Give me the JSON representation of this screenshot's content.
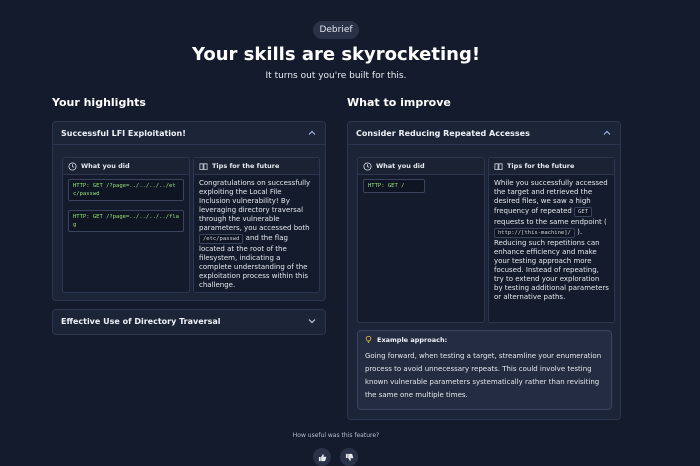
{
  "header": {
    "badge": "Debrief",
    "title": "Your skills are skyrocketing!",
    "subtitle": "It turns out you're built for this."
  },
  "highlights": {
    "heading": "Your highlights",
    "panel1": {
      "title": "Successful LFI Exploitation!",
      "what_you_did": "What you did",
      "tips": "Tips for the future",
      "code1": "HTTP: GET /?page=../../../../etc/passwd",
      "code2": "HTTP: GET /?page=../../../../flag",
      "tips_text_1": "Congratulations on successfully exploiting the Local File Inclusion vulnerability! By leveraging directory traversal through the vulnerable parameters, you accessed both",
      "tips_code": "/etc/passwd",
      "tips_text_2": "and the flag located at the root of the filesystem, indicating a complete understanding of the exploitation process within this challenge."
    },
    "panel2": {
      "title": "Effective Use of Directory Traversal"
    }
  },
  "improve": {
    "heading": "What to improve",
    "panel": {
      "title": "Consider Reducing Repeated Accesses",
      "what_you_did": "What you did",
      "tips": "Tips for the future",
      "code": "HTTP: GET /",
      "tips_text_1": "While you successfully accessed the target and retrieved the desired files, we saw a high frequency of repeated",
      "tips_code1": "GET",
      "tips_text_2": "requests to the same endpoint (",
      "tips_code2": "http://[this-machine]/",
      "tips_text_3": "). Reducing such repetitions can enhance efficiency and make your testing approach more focused. Instead of repeating, try to extend your exploration by testing additional parameters or alternative paths."
    },
    "example": {
      "title": "Example approach:",
      "text": "Going forward, when testing a target, streamline your enumeration process to avoid unnecessary repeats. This could involve testing known vulnerable parameters systematically rather than revisiting the same one multiple times."
    }
  },
  "footer": {
    "question": "How useful was this feature?"
  }
}
